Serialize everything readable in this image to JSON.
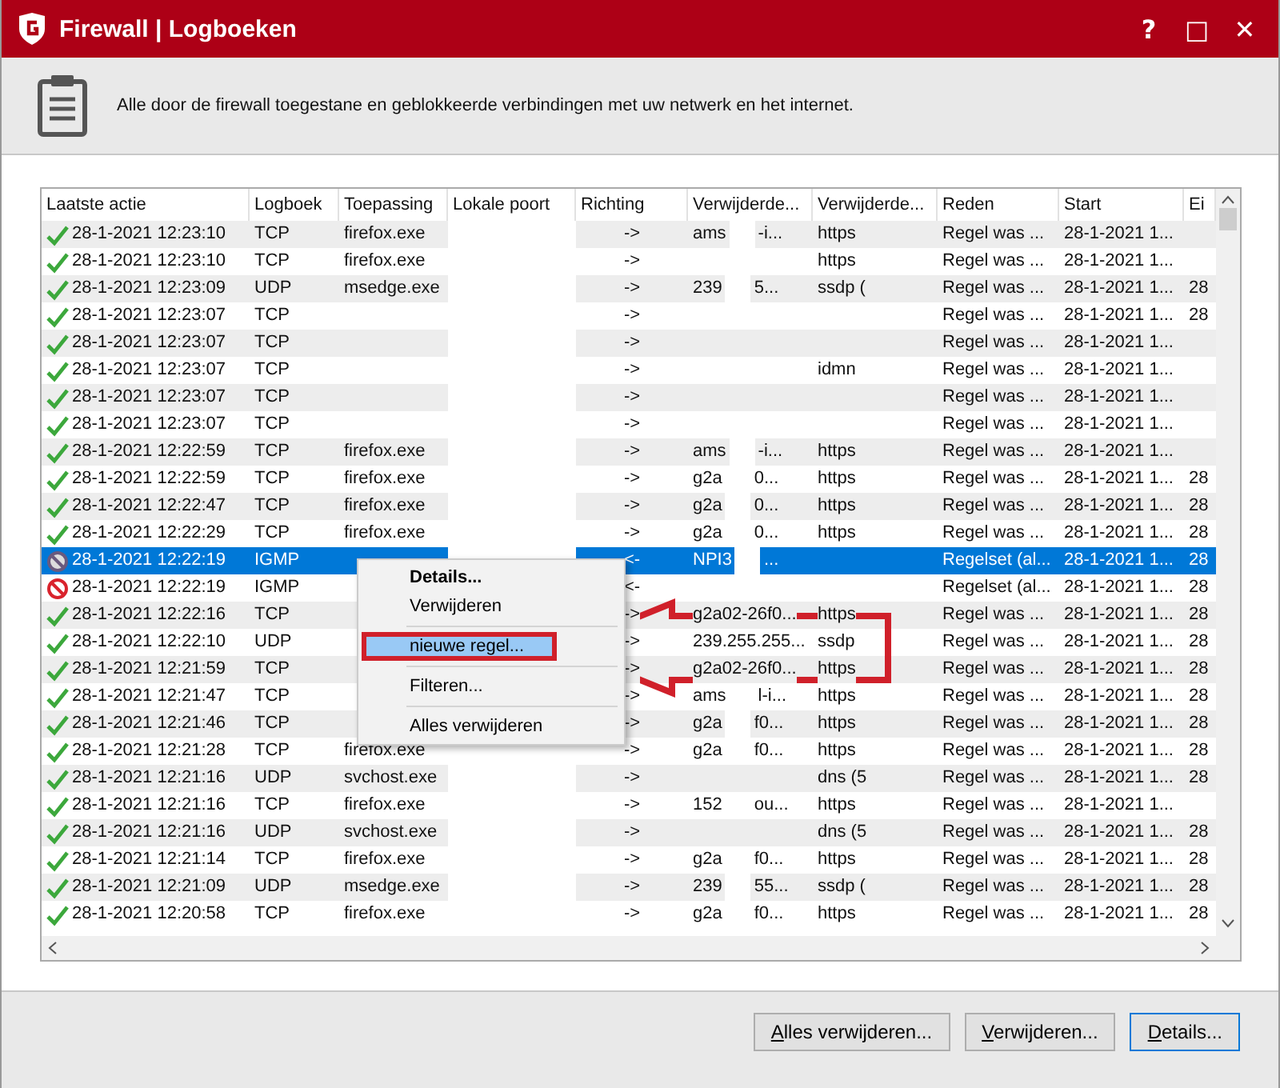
{
  "window": {
    "title": "Firewall | Logboeken",
    "controls": [
      "?",
      "□",
      "✕"
    ]
  },
  "description": "Alle door de firewall toegestane en geblokkeerde verbindingen met uw netwerk en het internet.",
  "table": {
    "columns": [
      "Laatste actie",
      "Logboek",
      "Toepassing",
      "Lokale poort",
      "Richting",
      "Verwijderde...",
      "Verwijderde...",
      "Reden",
      "Start",
      "Ei"
    ],
    "rows": [
      {
        "kind": "allowed",
        "selected": false,
        "cells": [
          "28-1-2021 12:23:10",
          "TCP",
          "firefox.exe",
          "",
          "->",
          [
            "ams",
            "-i..."
          ],
          "https",
          "Regel was ...",
          "28-1-2021 1...",
          ""
        ]
      },
      {
        "kind": "allowed",
        "selected": false,
        "cells": [
          "28-1-2021 12:23:10",
          "TCP",
          "firefox.exe",
          "",
          "->",
          "",
          "https",
          "Regel was ...",
          "28-1-2021 1...",
          ""
        ]
      },
      {
        "kind": "allowed",
        "selected": false,
        "cells": [
          "28-1-2021 12:23:09",
          "UDP",
          "msedge.exe",
          "",
          "->",
          [
            "239",
            "5..."
          ],
          "ssdp (",
          "Regel was ...",
          "28-1-2021 1...",
          "28"
        ]
      },
      {
        "kind": "allowed",
        "selected": false,
        "cells": [
          "28-1-2021 12:23:07",
          "TCP",
          "",
          "",
          "->",
          "",
          "",
          "Regel was ...",
          "28-1-2021 1...",
          "28"
        ]
      },
      {
        "kind": "allowed",
        "selected": false,
        "cells": [
          "28-1-2021 12:23:07",
          "TCP",
          "",
          "",
          "->",
          "",
          "",
          "Regel was ...",
          "28-1-2021 1...",
          ""
        ]
      },
      {
        "kind": "allowed",
        "selected": false,
        "cells": [
          "28-1-2021 12:23:07",
          "TCP",
          "",
          "",
          "->",
          "",
          "idmn",
          "Regel was ...",
          "28-1-2021 1...",
          ""
        ]
      },
      {
        "kind": "allowed",
        "selected": false,
        "cells": [
          "28-1-2021 12:23:07",
          "TCP",
          "",
          "",
          "->",
          "",
          "",
          "Regel was ...",
          "28-1-2021 1...",
          ""
        ]
      },
      {
        "kind": "allowed",
        "selected": false,
        "cells": [
          "28-1-2021 12:23:07",
          "TCP",
          "",
          "",
          "->",
          "",
          "",
          "Regel was ...",
          "28-1-2021 1...",
          ""
        ]
      },
      {
        "kind": "allowed",
        "selected": false,
        "cells": [
          "28-1-2021 12:22:59",
          "TCP",
          "firefox.exe",
          "",
          "->",
          [
            "ams",
            "-i..."
          ],
          "https",
          "Regel was ...",
          "28-1-2021 1...",
          ""
        ]
      },
      {
        "kind": "allowed",
        "selected": false,
        "cells": [
          "28-1-2021 12:22:59",
          "TCP",
          "firefox.exe",
          "",
          "->",
          [
            "g2a",
            "0..."
          ],
          "https",
          "Regel was ...",
          "28-1-2021 1...",
          "28"
        ]
      },
      {
        "kind": "allowed",
        "selected": false,
        "cells": [
          "28-1-2021 12:22:47",
          "TCP",
          "firefox.exe",
          "",
          "->",
          [
            "g2a",
            "0..."
          ],
          "https",
          "Regel was ...",
          "28-1-2021 1...",
          "28"
        ]
      },
      {
        "kind": "allowed",
        "selected": false,
        "cells": [
          "28-1-2021 12:22:29",
          "TCP",
          "firefox.exe",
          "",
          "->",
          [
            "g2a",
            "0..."
          ],
          "https",
          "Regel was ...",
          "28-1-2021 1...",
          "28"
        ]
      },
      {
        "kind": "blocked",
        "selected": true,
        "cells": [
          "28-1-2021 12:22:19",
          "IGMP",
          "",
          "",
          "<-",
          [
            "NPI3",
            "..."
          ],
          "",
          "Regelset (al...",
          "28-1-2021 1...",
          "28"
        ]
      },
      {
        "kind": "blocked",
        "selected": false,
        "cells": [
          "28-1-2021 12:22:19",
          "IGMP",
          "",
          "",
          "<-",
          "",
          "",
          "Regelset (al...",
          "28-1-2021 1...",
          "28"
        ]
      },
      {
        "kind": "allowed",
        "selected": false,
        "cells": [
          "28-1-2021 12:22:16",
          "TCP",
          "",
          "",
          "->",
          "g2a02-26f0...",
          "https",
          "Regel was ...",
          "28-1-2021 1...",
          "28"
        ]
      },
      {
        "kind": "allowed",
        "selected": false,
        "cells": [
          "28-1-2021 12:22:10",
          "UDP",
          "",
          "",
          "->",
          "239.255.255...",
          "ssdp",
          "Regel was ...",
          "28-1-2021 1...",
          "28"
        ]
      },
      {
        "kind": "allowed",
        "selected": false,
        "cells": [
          "28-1-2021 12:21:59",
          "TCP",
          "",
          "",
          "->",
          "g2a02-26f0...",
          "https",
          "Regel was ...",
          "28-1-2021 1...",
          "28"
        ]
      },
      {
        "kind": "allowed",
        "selected": false,
        "cells": [
          "28-1-2021 12:21:47",
          "TCP",
          "",
          "",
          "->",
          [
            "ams",
            "l-i..."
          ],
          "https",
          "Regel was ...",
          "28-1-2021 1...",
          "28"
        ]
      },
      {
        "kind": "allowed",
        "selected": false,
        "cells": [
          "28-1-2021 12:21:46",
          "TCP",
          "",
          "",
          "->",
          [
            "g2a",
            "f0..."
          ],
          "https",
          "Regel was ...",
          "28-1-2021 1...",
          "28"
        ]
      },
      {
        "kind": "allowed",
        "selected": false,
        "cells": [
          "28-1-2021 12:21:28",
          "TCP",
          "firefox.exe",
          "",
          "->",
          [
            "g2a",
            "f0..."
          ],
          "https",
          "Regel was ...",
          "28-1-2021 1...",
          "28"
        ]
      },
      {
        "kind": "allowed",
        "selected": false,
        "cells": [
          "28-1-2021 12:21:16",
          "UDP",
          "svchost.exe",
          "",
          "->",
          "",
          "dns (5",
          "Regel was ...",
          "28-1-2021 1...",
          "28"
        ]
      },
      {
        "kind": "allowed",
        "selected": false,
        "cells": [
          "28-1-2021 12:21:16",
          "TCP",
          "firefox.exe",
          "",
          "->",
          [
            "152",
            "ou..."
          ],
          "https",
          "Regel was ...",
          "28-1-2021 1...",
          ""
        ]
      },
      {
        "kind": "allowed",
        "selected": false,
        "cells": [
          "28-1-2021 12:21:16",
          "UDP",
          "svchost.exe",
          "",
          "->",
          "",
          "dns (5",
          "Regel was ...",
          "28-1-2021 1...",
          "28"
        ]
      },
      {
        "kind": "allowed",
        "selected": false,
        "cells": [
          "28-1-2021 12:21:14",
          "TCP",
          "firefox.exe",
          "",
          "->",
          [
            "g2a",
            "f0..."
          ],
          "https",
          "Regel was ...",
          "28-1-2021 1...",
          "28"
        ]
      },
      {
        "kind": "allowed",
        "selected": false,
        "cells": [
          "28-1-2021 12:21:09",
          "UDP",
          "msedge.exe",
          "",
          "->",
          [
            "239",
            "55..."
          ],
          "ssdp (",
          "Regel was ...",
          "28-1-2021 1...",
          "28"
        ]
      },
      {
        "kind": "allowed",
        "selected": false,
        "cells": [
          "28-1-2021 12:20:58",
          "TCP",
          "firefox.exe",
          "",
          "->",
          [
            "g2a",
            "f0..."
          ],
          "https",
          "Regel was ...",
          "28-1-2021 1...",
          "28"
        ]
      }
    ]
  },
  "context_menu": [
    {
      "kind": "item",
      "label": "Details...",
      "bold": true,
      "selected": false
    },
    {
      "kind": "item",
      "label": "Verwijderen",
      "bold": false,
      "selected": false
    },
    {
      "kind": "separator"
    },
    {
      "kind": "item",
      "label": "nieuwe regel...",
      "bold": false,
      "selected": true
    },
    {
      "kind": "separator"
    },
    {
      "kind": "item",
      "label": "Filteren...",
      "bold": false,
      "selected": false
    },
    {
      "kind": "separator"
    },
    {
      "kind": "item",
      "label": "Alles verwijderen",
      "bold": false,
      "selected": false
    }
  ],
  "buttons": [
    {
      "label": "Alles verwijderen...",
      "default": false
    },
    {
      "label": "Verwijderen...",
      "default": false
    },
    {
      "label": "Details...",
      "default": true
    }
  ]
}
